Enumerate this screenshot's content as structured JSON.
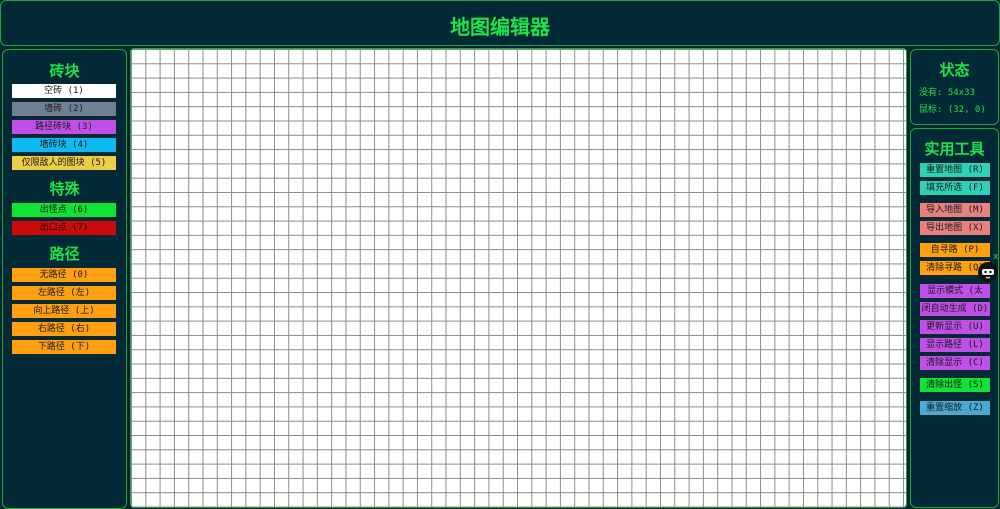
{
  "header": {
    "title": "地图编辑器"
  },
  "tiles": {
    "title": "砖块",
    "items": [
      {
        "label": "空砖 (1)",
        "color": "#ffffff",
        "text": "#1a1a1a"
      },
      {
        "label": "墙砖 (2)",
        "color": "#708090",
        "text": "#1a1a1a"
      },
      {
        "label": "路径砖块 (3)",
        "color": "#bf4fe8",
        "text": "#1a1a1a"
      },
      {
        "label": "墙砖块 (4)",
        "color": "#0dbbf2",
        "text": "#1a1a1a"
      },
      {
        "label": "仅限敌人的图块 (5)",
        "color": "#eacd48",
        "text": "#1a1a1a"
      }
    ]
  },
  "special": {
    "title": "特殊",
    "items": [
      {
        "label": "出怪点 (6)",
        "color": "#11e235",
        "text": "#1a1a1a"
      },
      {
        "label": "出口点 (7)",
        "color": "#c90b0b",
        "text": "#2a0000"
      }
    ]
  },
  "paths": {
    "title": "路径",
    "items": [
      {
        "label": "无路径 (0)",
        "color": "#ff9f12"
      },
      {
        "label": "左路径 (左)",
        "color": "#ff9f12"
      },
      {
        "label": "向上路径 (上)",
        "color": "#ff9f12"
      },
      {
        "label": "右路径 (右)",
        "color": "#ff9f12"
      },
      {
        "label": "下路径 (下)",
        "color": "#ff9f12"
      }
    ]
  },
  "status": {
    "title": "状态",
    "size_line": "没有: 54x33",
    "mouse_line": "鼠标: (32, 0)"
  },
  "tools": {
    "title": "实用工具",
    "items": [
      {
        "label": "重置地图 (R)",
        "color": "#2fd1b4"
      },
      {
        "label": "填充所选 (F)",
        "color": "#2fd1b4"
      },
      {
        "label": "导入地图 (M)",
        "color": "#e88080"
      },
      {
        "label": "导出地图 (X)",
        "color": "#e88080"
      },
      {
        "label": "自寻路 (P)",
        "color": "#ff9f12"
      },
      {
        "label": "清除寻路 (Q)",
        "color": "#ff9f12"
      },
      {
        "label": "显示模式 (太空)",
        "color": "#bf4fe8"
      },
      {
        "label": "闭自动生成 (D)",
        "color": "#bf4fe8"
      },
      {
        "label": "更新显示 (U)",
        "color": "#bf4fe8"
      },
      {
        "label": "显示路径 (L)",
        "color": "#bf4fe8"
      },
      {
        "label": "清除显示 (C)",
        "color": "#bf4fe8"
      },
      {
        "label": "清除出怪 (S)",
        "color": "#11e235"
      },
      {
        "label": "重置缩放 (Z)",
        "color": "#4aa9d2"
      }
    ]
  },
  "helper": {
    "icon": "ninja-cat-icon",
    "close_label": "x"
  }
}
